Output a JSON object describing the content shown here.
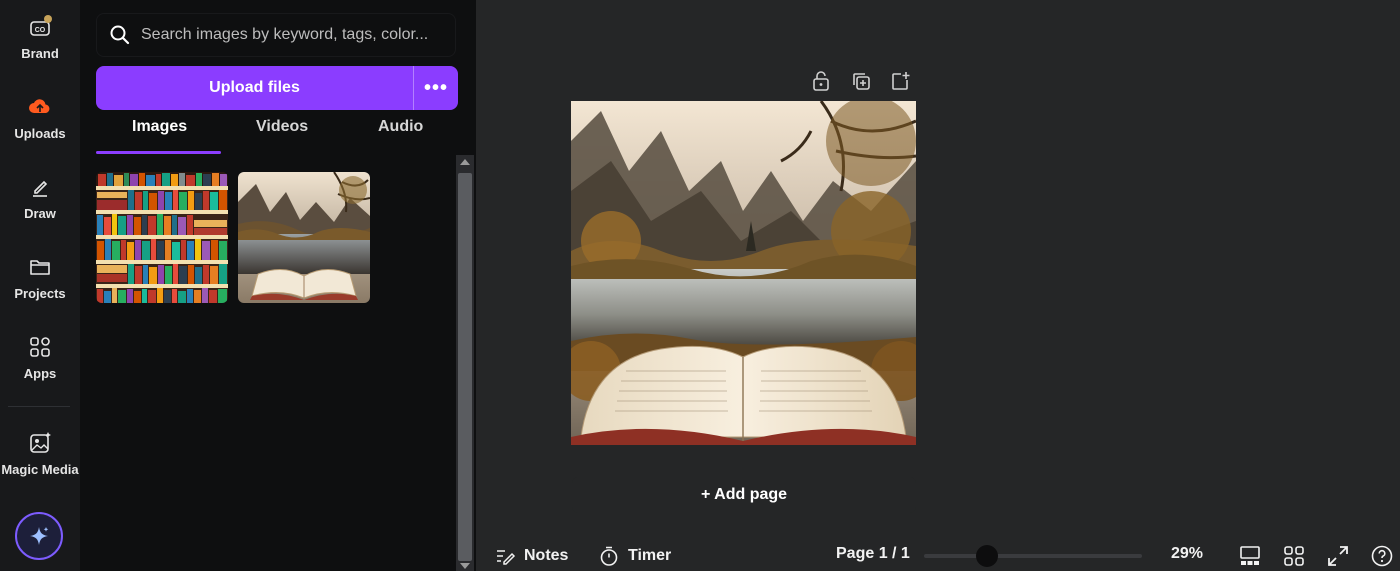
{
  "rail": {
    "items": [
      {
        "label": "Brand",
        "icon": "brand-icon"
      },
      {
        "label": "Uploads",
        "icon": "cloud-upload-icon"
      },
      {
        "label": "Draw",
        "icon": "pen-icon"
      },
      {
        "label": "Projects",
        "icon": "folder-icon"
      },
      {
        "label": "Apps",
        "icon": "apps-grid-icon"
      },
      {
        "label": "Magic Media",
        "icon": "magic-media-icon"
      }
    ]
  },
  "panel": {
    "search_placeholder": "Search images by keyword, tags, color...",
    "upload_label": "Upload files",
    "more_label": "•••",
    "tabs": [
      {
        "label": "Images",
        "active": true
      },
      {
        "label": "Videos",
        "active": false
      },
      {
        "label": "Audio",
        "active": false
      }
    ]
  },
  "canvas": {
    "add_page_label": "+ Add page"
  },
  "bottom": {
    "notes_label": "Notes",
    "timer_label": "Timer",
    "page_label": "Page 1 / 1",
    "zoom_label": "29%",
    "zoom_fraction": 0.29
  },
  "colors": {
    "accent": "#8b3dff",
    "upload_icon": "#ff5a1f"
  }
}
